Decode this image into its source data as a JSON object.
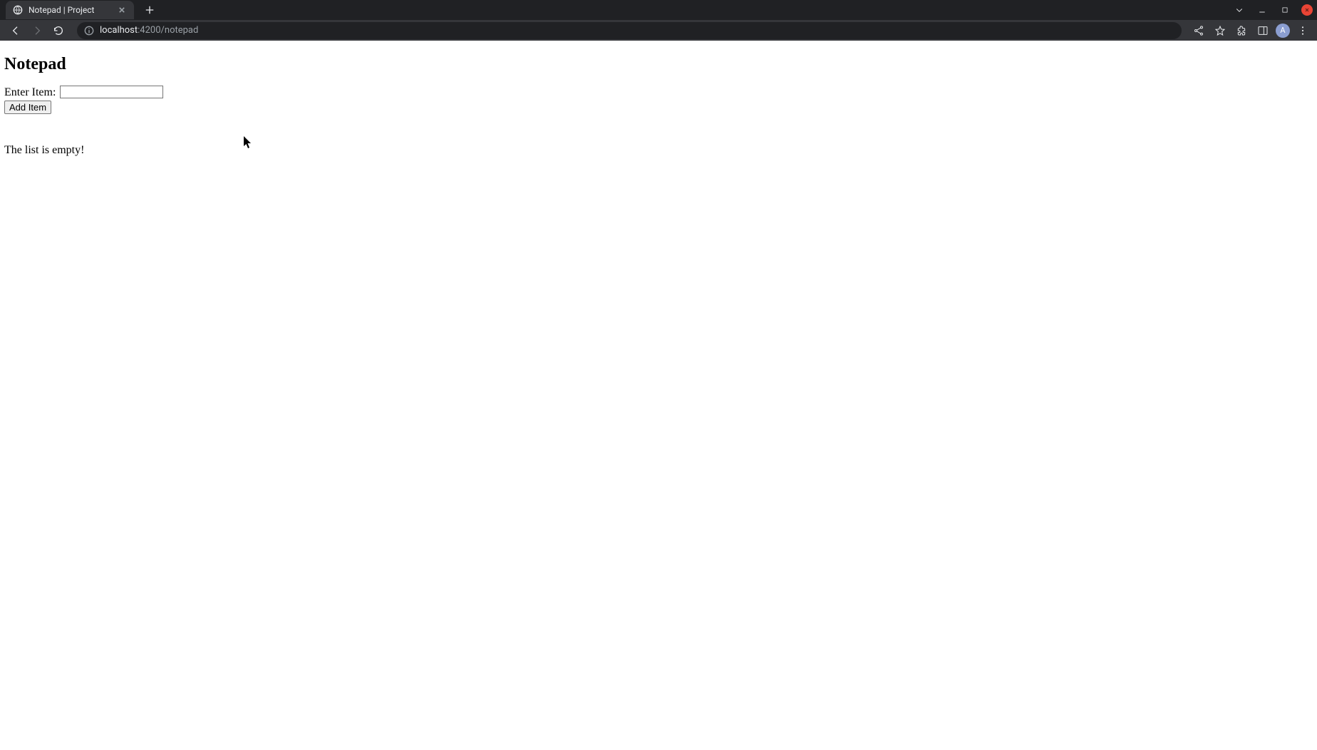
{
  "browser": {
    "tab_title": "Notepad | Project",
    "url_host": "localhost",
    "url_path": ":4200/notepad",
    "avatar_letter": "A"
  },
  "page": {
    "heading": "Notepad",
    "form": {
      "label": "Enter Item:",
      "input_value": "",
      "button_label": "Add Item"
    },
    "empty_message": "The list is empty!"
  }
}
